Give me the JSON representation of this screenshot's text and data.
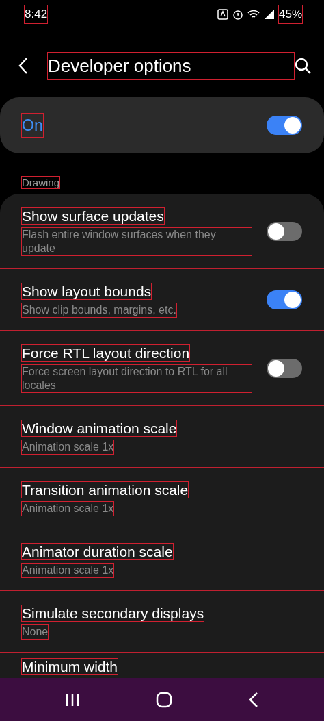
{
  "status_bar": {
    "time": "8:42",
    "battery": "45%"
  },
  "header": {
    "title": "Developer options"
  },
  "master": {
    "label": "On",
    "on": true
  },
  "section": {
    "title": "Drawing"
  },
  "settings": [
    {
      "kind": "toggle",
      "title": "Show surface updates",
      "summary": "Flash entire window surfaces when they update",
      "on": false
    },
    {
      "kind": "toggle",
      "title": "Show layout bounds",
      "summary": "Show clip bounds, margins, etc.",
      "on": true
    },
    {
      "kind": "toggle",
      "title": "Force RTL layout direction",
      "summary": "Force screen layout direction to RTL for all locales",
      "on": false
    },
    {
      "kind": "value",
      "title": "Window animation scale",
      "summary": "Animation scale 1x"
    },
    {
      "kind": "value",
      "title": "Transition animation scale",
      "summary": "Animation scale 1x"
    },
    {
      "kind": "value",
      "title": "Animator duration scale",
      "summary": "Animation scale 1x"
    },
    {
      "kind": "value",
      "title": "Simulate secondary displays",
      "summary": "None"
    },
    {
      "kind": "value",
      "title": "Minimum width"
    }
  ]
}
